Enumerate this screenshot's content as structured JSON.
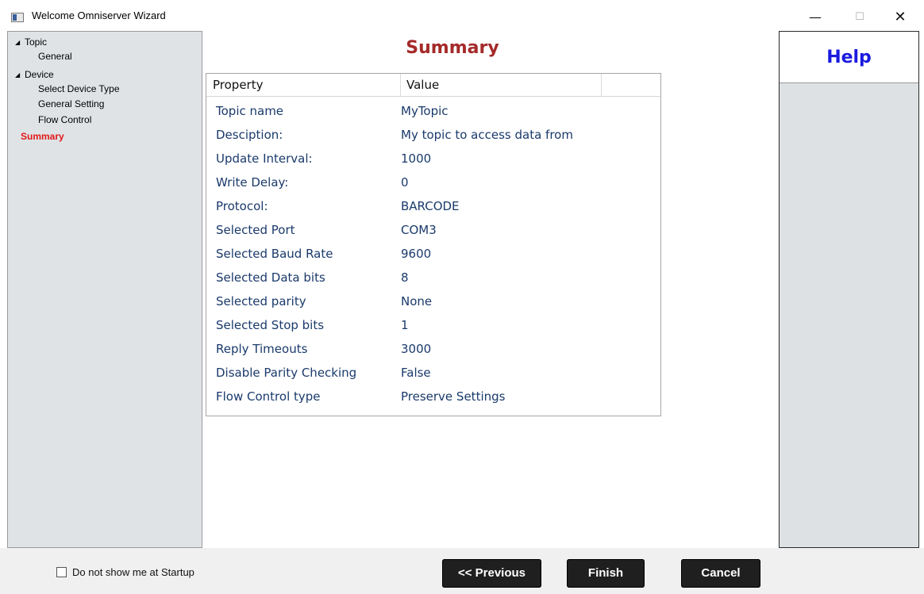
{
  "window": {
    "title": "Welcome Omniserver Wizard",
    "minimize": "—",
    "maximize": "☐",
    "close": "✕"
  },
  "tree": {
    "arrow": "◢",
    "topic": "Topic",
    "general": "General",
    "device": "Device",
    "select_device_type": "Select Device Type",
    "general_setting": "General Setting",
    "flow_control": "Flow Control",
    "summary": "Summary",
    "active_color": "#e01a1a"
  },
  "page_title": "Summary",
  "table": {
    "headers": {
      "property": "Property",
      "value": "Value"
    },
    "rows": [
      {
        "property": "Topic name",
        "value": "MyTopic"
      },
      {
        "property": "Desciption:",
        "value": "My topic to access data from"
      },
      {
        "property": "Update Interval:",
        "value": "1000"
      },
      {
        "property": "Write Delay:",
        "value": "0"
      },
      {
        "property": "Protocol:",
        "value": "BARCODE"
      },
      {
        "property": "Selected Port",
        "value": "COM3"
      },
      {
        "property": "Selected Baud Rate",
        "value": "9600"
      },
      {
        "property": "Selected Data bits",
        "value": "8"
      },
      {
        "property": "Selected parity",
        "value": "None"
      },
      {
        "property": "Selected Stop bits",
        "value": "1"
      },
      {
        "property": "Reply Timeouts",
        "value": "3000"
      },
      {
        "property": "Disable Parity Checking",
        "value": "False"
      },
      {
        "property": "Flow Control type",
        "value": "Preserve Settings"
      }
    ]
  },
  "help": {
    "title": "Help"
  },
  "footer": {
    "startup_checkbox_label": "Do not show me at Startup",
    "startup_checked": false,
    "previous_label": "<< Previous",
    "finish_label": "Finish",
    "cancel_label": "Cancel"
  }
}
